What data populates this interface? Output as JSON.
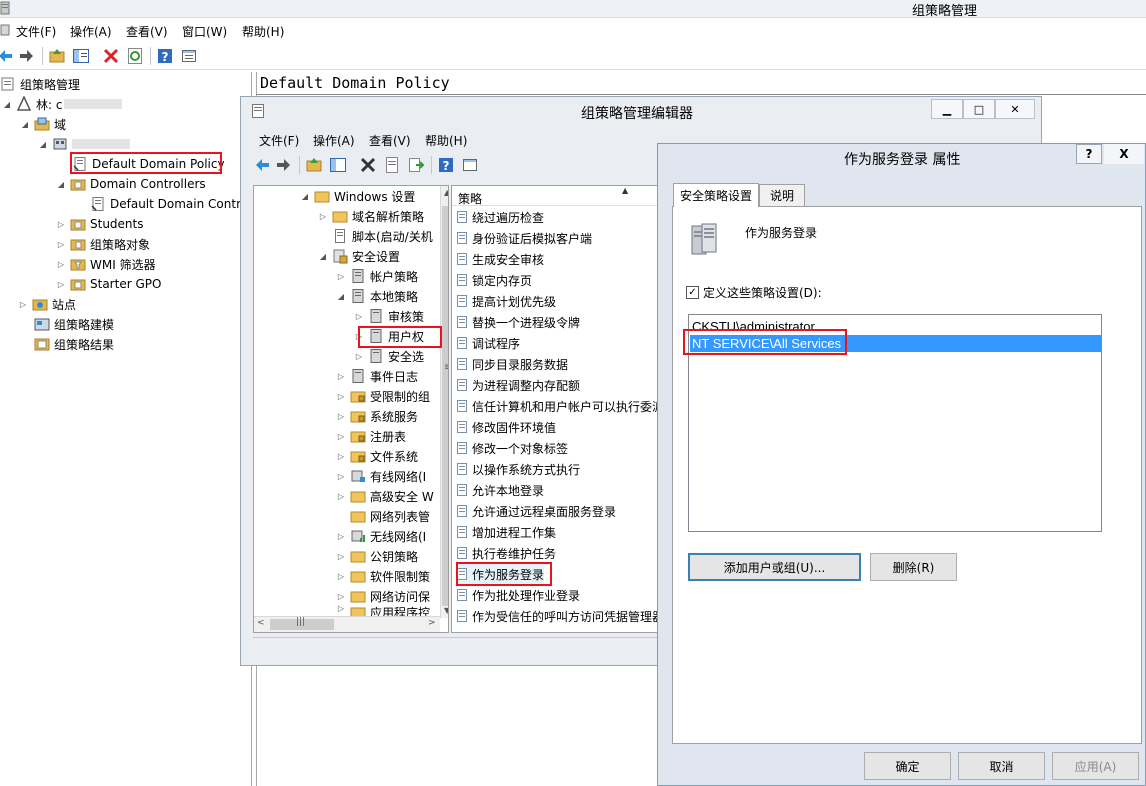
{
  "main_window": {
    "title": "组策略管理",
    "menu": [
      "文件(F)",
      "操作(A)",
      "查看(V)",
      "窗口(W)",
      "帮助(H)"
    ],
    "tree": {
      "root": "组策略管理",
      "forest": "林: c",
      "domains": "域",
      "domain_name": "",
      "default_domain_policy": "Default Domain Policy",
      "domain_controllers": "Domain Controllers",
      "default_domain_controllers": "Default Domain Contro",
      "students": "Students",
      "gpo_objects": "组策略对象",
      "wmi_filters": "WMI 筛选器",
      "starter_gpo": "Starter GPO",
      "sites": "站点",
      "gp_modeling": "组策略建模",
      "gp_results": "组策略结果"
    },
    "policy_title": "Default Domain Policy"
  },
  "editor_window": {
    "title": "组策略管理编辑器",
    "menu": [
      "文件(F)",
      "操作(A)",
      "查看(V)",
      "帮助(H)"
    ],
    "tree": {
      "windows_settings": "Windows 设置",
      "name_resolution": "域名解析策略",
      "scripts": "脚本(启动/关机",
      "security_settings": "安全设置",
      "account_policies": "帐户策略",
      "local_policies": "本地策略",
      "audit_policy": "审核策",
      "user_rights": "用户权",
      "security_options": "安全选",
      "event_log": "事件日志",
      "restricted_groups": "受限制的组",
      "system_services": "系统服务",
      "registry": "注册表",
      "file_system": "文件系统",
      "wired_network": "有线网络(I",
      "advanced_security": "高级安全 W",
      "network_list": "网络列表管",
      "wireless_network": "无线网络(I",
      "public_key": "公钥策略",
      "software_restriction": "软件限制策",
      "network_access": "网络访问保",
      "app_control": "应用程序控"
    },
    "list_header": "策略",
    "policies": [
      "绕过遍历检查",
      "身份验证后模拟客户端",
      "生成安全审核",
      "锁定内存页",
      "提高计划优先级",
      "替换一个进程级令牌",
      "调试程序",
      "同步目录服务数据",
      "为进程调整内存配额",
      "信任计算机和用户帐户可以执行委派",
      "修改固件环境值",
      "修改一个对象标签",
      "以操作系统方式执行",
      "允许本地登录",
      "允许通过远程桌面服务登录",
      "增加进程工作集",
      "执行卷维护任务",
      "作为服务登录",
      "作为批处理作业登录",
      "作为受信任的呼叫方访问凭据管理器"
    ]
  },
  "properties_dialog": {
    "title": "作为服务登录 属性",
    "help_label": "?",
    "close_label": "X",
    "tabs": [
      "安全策略设置",
      "说明"
    ],
    "policy_name": "作为服务登录",
    "define_label": "定义这些策略设置(D):",
    "define_checked": true,
    "accounts": [
      "CKSTU\\administrator",
      "NT SERVICE\\All Services"
    ],
    "selected_account": "NT SERVICE\\All Services",
    "add_button": "添加用户或组(U)...",
    "remove_button": "删除(R)",
    "ok_button": "确定",
    "cancel_button": "取消",
    "apply_button": "应用(A)"
  },
  "colors": {
    "highlight_box": "#e8141e",
    "selection": "#3399ff"
  }
}
